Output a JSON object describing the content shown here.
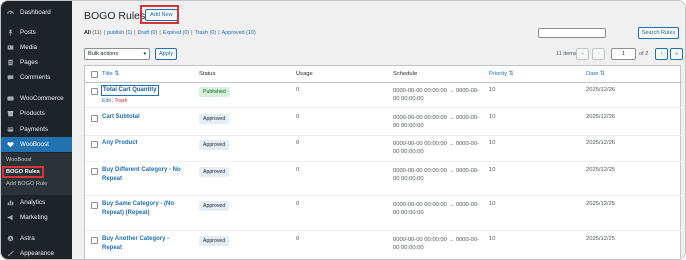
{
  "sidebar": {
    "items": [
      {
        "label": "Dashboard",
        "icon": "dashboard-icon"
      },
      {
        "label": "Posts",
        "icon": "pin-icon"
      },
      {
        "label": "Media",
        "icon": "media-icon"
      },
      {
        "label": "Pages",
        "icon": "page-icon"
      },
      {
        "label": "Comments",
        "icon": "comment-icon"
      },
      {
        "label": "WooCommerce",
        "icon": "woo-icon"
      },
      {
        "label": "Products",
        "icon": "box-icon"
      },
      {
        "label": "Payments",
        "icon": "card-icon"
      },
      {
        "label": "WooBoost",
        "icon": "heart-icon"
      },
      {
        "label": "Analytics",
        "icon": "bar-chart-icon"
      },
      {
        "label": "Marketing",
        "icon": "megaphone-icon"
      },
      {
        "label": "Astra",
        "icon": "astra-icon"
      },
      {
        "label": "Appearance",
        "icon": "brush-icon"
      }
    ],
    "submenu": [
      "WooBoost",
      "BOGO Rules",
      "Add BOGO Rule"
    ]
  },
  "header": {
    "title": "BOGO Rules",
    "add_new": "Add New"
  },
  "filters": {
    "all": "All",
    "all_count": "(11)",
    "links": [
      "publish (1)",
      "Draft (0)",
      "Expired (0)",
      "Trash (0)",
      "Approved (10)"
    ]
  },
  "search": {
    "button": "Search Rules",
    "value": ""
  },
  "bulk": {
    "label": "Bulk actions",
    "apply": "Apply"
  },
  "pagination": {
    "items": "11 items",
    "first": "«",
    "prev": "‹",
    "current": "1",
    "of": "of 2",
    "next": "›",
    "last": "»"
  },
  "table": {
    "headers": {
      "title": "Title ⇅",
      "status": "Status",
      "usage": "Usage",
      "schedule": "Schedule",
      "priority": "Priority ⇅",
      "date": "Date ⇅"
    },
    "row_actions": {
      "edit": "Edit",
      "trash": "Trash"
    },
    "rows": [
      {
        "title": "Total Cart Quantity",
        "status": "Published",
        "usage": "0",
        "schedule": "0000-00-00 00:00:00 → 0000-00-00 00:00:00",
        "priority": "10",
        "date": "2025/12/26"
      },
      {
        "title": "Cart Subtotal",
        "status": "Approved",
        "usage": "0",
        "schedule": "0000-00-00 00:00:00 → 0000-00-00 00:00:00",
        "priority": "10",
        "date": "2025/12/26"
      },
      {
        "title": "Any Product",
        "status": "Approved",
        "usage": "0",
        "schedule": "0000-00-00 00:00:00 → 0000-00-00 00:00:00",
        "priority": "10",
        "date": "2025/12/26"
      },
      {
        "title": "Buy Different Category - No Repeat",
        "status": "Approved",
        "usage": "0",
        "schedule": "0000-00-00 00:00:00 → 0000-00-00 00:00:00",
        "priority": "10",
        "date": "2025/12/25"
      },
      {
        "title": "Buy Same Category - (No Repeat) (Repeat)",
        "status": "Approved",
        "usage": "0",
        "schedule": "0000-00-00 00:00:00 → 0000-00-00 00:00:00",
        "priority": "10",
        "date": "2025/12/25"
      },
      {
        "title": "Buy Another Category - Repeat",
        "status": "Approved",
        "usage": "0",
        "schedule": "0000-00-00 00:00:00 → 0000-00-00 00:00:00",
        "priority": "10",
        "date": "2025/12/25"
      }
    ]
  },
  "colors": {
    "sidebar": "#1d2327",
    "accent": "#2271b1",
    "highlight": "#d63638",
    "published": "#d7f0dc",
    "approved": "#e6ecf5"
  }
}
